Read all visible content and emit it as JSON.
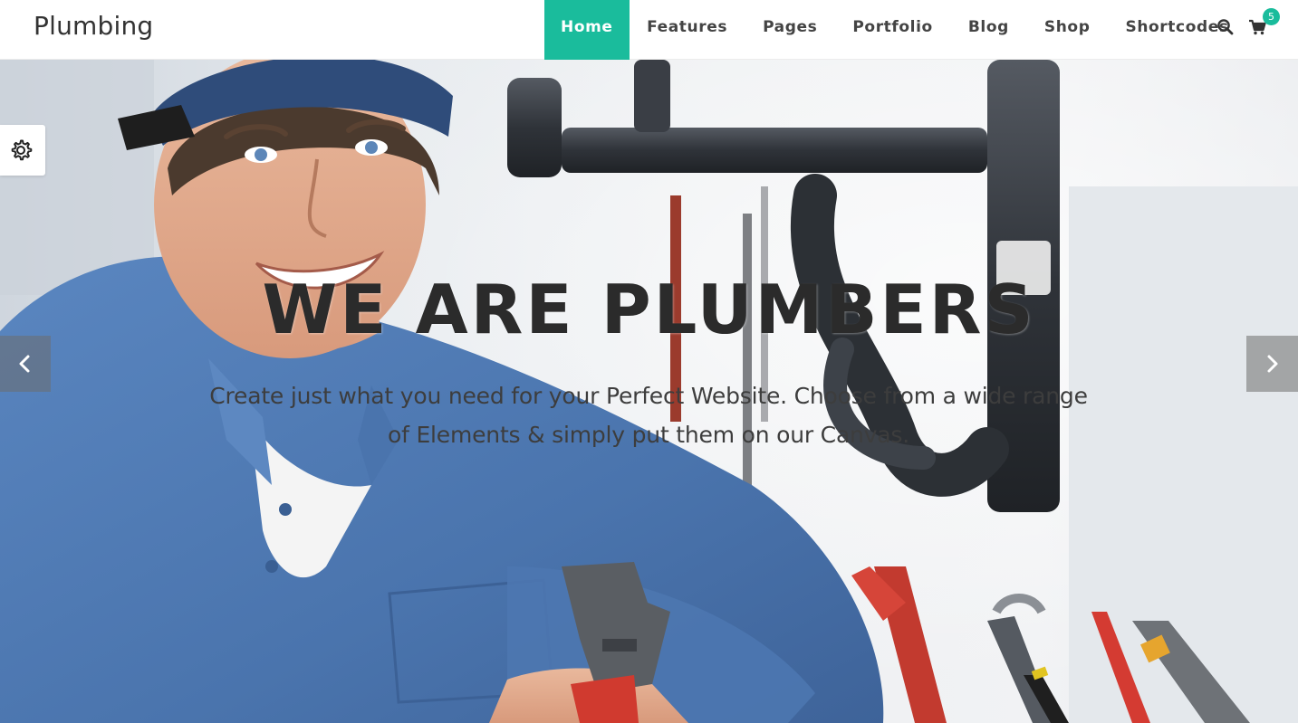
{
  "header": {
    "logo": "Plumbing",
    "nav": [
      {
        "label": "Home",
        "active": true
      },
      {
        "label": "Features",
        "active": false
      },
      {
        "label": "Pages",
        "active": false
      },
      {
        "label": "Portfolio",
        "active": false
      },
      {
        "label": "Blog",
        "active": false
      },
      {
        "label": "Shop",
        "active": false
      },
      {
        "label": "Shortcodes",
        "active": false
      }
    ],
    "search_icon": "search-icon",
    "cart_icon": "cart-icon",
    "cart_count": "5"
  },
  "hero": {
    "title": "WE ARE PLUMBERS",
    "subtitle_line1": "Create just what you need for your Perfect Website. Choose from a wide range",
    "subtitle_line2": "of Elements & simply put them on our Canvas.",
    "prev_icon": "chevron-left-icon",
    "next_icon": "chevron-right-icon",
    "settings_icon": "gear-icon"
  },
  "colors": {
    "accent": "#1abc9c",
    "nav_text": "#444444",
    "title_text": "#2b2b2b",
    "shirt_blue": "#4f7bb5"
  }
}
